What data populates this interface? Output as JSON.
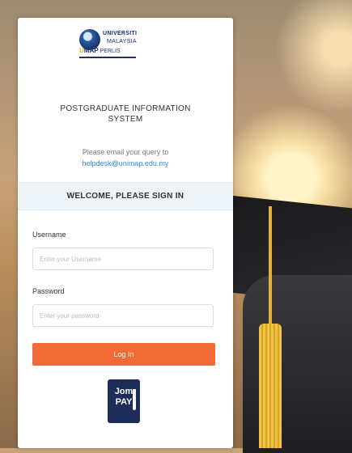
{
  "logo": {
    "line1": "UNIVERSITI",
    "line2": "MALAYSIA",
    "line3": "PERLIS",
    "mark_prefix": "U",
    "mark_suffix": "MAP"
  },
  "system_title": {
    "line1": "POSTGRADUATE INFORMATION",
    "line2": "SYSTEM"
  },
  "query": {
    "text": "Please email your query to",
    "email": "helpdesk@unimap.edu.my"
  },
  "welcome": "WELCOME, PLEASE SIGN IN",
  "username": {
    "label": "Username",
    "placeholder": "Enter your Username",
    "value": ""
  },
  "password": {
    "label": "Password",
    "placeholder": "Enter your password",
    "value": ""
  },
  "login_button": "Log In",
  "jompay": {
    "line1": "Jom",
    "line2": "PAY"
  },
  "colors": {
    "accent": "#f26a36",
    "link": "#3a86d4",
    "brand_navy": "#1d2f6a",
    "jompay_bg": "#1e2c5a"
  }
}
